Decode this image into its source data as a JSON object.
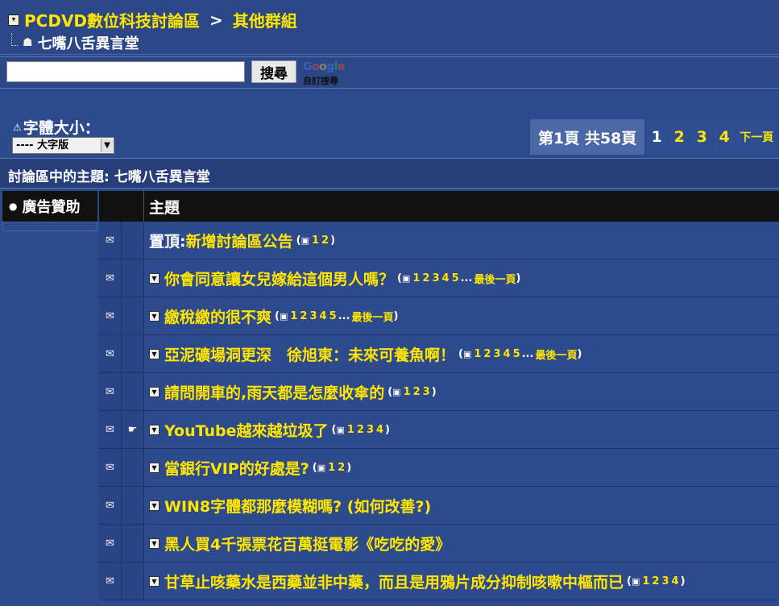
{
  "breadcrumb": {
    "forum": "PCDVD數位科技討論區",
    "separator": ">",
    "group": "其他群組",
    "board": "七嘴八舌異言堂"
  },
  "search": {
    "button_label": "搜尋",
    "google_text": "Google",
    "google_sub": "自訂搜尋"
  },
  "font_size": {
    "label": "字體大小：",
    "selected": "---- 大字版"
  },
  "pagination": {
    "info": "第1頁 共58頁",
    "pages": [
      "1",
      "2",
      "3",
      "4"
    ],
    "current": "1",
    "next": "下一頁"
  },
  "section_title": "討論區中的主題: 七嘴八舌異言堂",
  "ad": {
    "label": "廣告贊助"
  },
  "table": {
    "topic_header": "主題"
  },
  "threads": [
    {
      "prefix": "置頂: ",
      "title": "新增討論區公告",
      "pages": [
        "1",
        "2"
      ],
      "last": "",
      "icon": "✉",
      "icon2": ""
    },
    {
      "prefix": "",
      "title": "你會同意讓女兒嫁給這個男人嗎？",
      "pages": [
        "1",
        "2",
        "3",
        "4",
        "5"
      ],
      "last": "最後一頁",
      "icon": "✉",
      "icon2": ""
    },
    {
      "prefix": "",
      "title": "繳稅繳的很不爽",
      "pages": [
        "1",
        "2",
        "3",
        "4",
        "5"
      ],
      "last": "最後一頁",
      "icon": "✉",
      "icon2": ""
    },
    {
      "prefix": "",
      "title": "亞泥礦場洞更深　徐旭東：未來可養魚啊！",
      "pages": [
        "1",
        "2",
        "3",
        "4",
        "5"
      ],
      "last": "最後一頁",
      "icon": "✉",
      "icon2": ""
    },
    {
      "prefix": "",
      "title": "請問開車的,雨天都是怎麼收傘的",
      "pages": [
        "1",
        "2",
        "3"
      ],
      "last": "",
      "icon": "✉",
      "icon2": ""
    },
    {
      "prefix": "",
      "title": "YouTube越來越垃圾了",
      "pages": [
        "1",
        "2",
        "3",
        "4"
      ],
      "last": "",
      "icon": "✉",
      "icon2": "☛"
    },
    {
      "prefix": "",
      "title": "當銀行VIP的好處是?",
      "pages": [
        "1",
        "2"
      ],
      "last": "",
      "icon": "✉",
      "icon2": ""
    },
    {
      "prefix": "",
      "title": "WIN8字體都那麼模糊嗎? (如何改善?)",
      "pages": [],
      "last": "",
      "icon": "✉",
      "icon2": ""
    },
    {
      "prefix": "",
      "title": "黑人買4千張票花百萬挺電影《吃吃的愛》",
      "pages": [],
      "last": "",
      "icon": "✉",
      "icon2": ""
    },
    {
      "prefix": "",
      "title": "甘草止咳藥水是西藥並非中藥，而且是用鴉片成分抑制咳嗽中樞而已",
      "pages": [
        "1",
        "2",
        "3",
        "4"
      ],
      "last": "",
      "icon": "✉",
      "icon2": ""
    }
  ],
  "colors": {
    "background": "#2d4a8c",
    "link": "#ffe600",
    "header_bar": "#111111"
  }
}
